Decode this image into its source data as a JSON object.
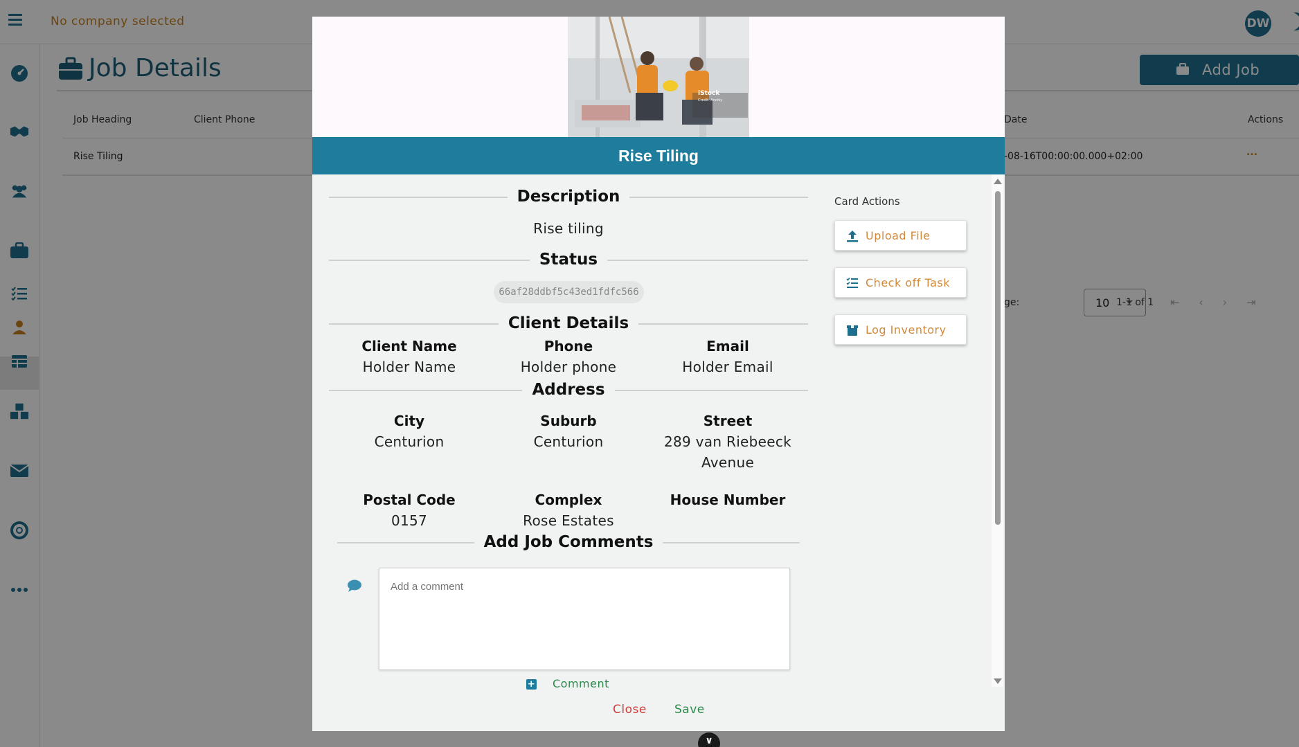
{
  "app": {
    "company_status": "No company selected",
    "user_initials": "DW"
  },
  "page": {
    "title": "Job Details",
    "add_job_label": "Add Job"
  },
  "table": {
    "headers": [
      "Job Heading",
      "Client Phone",
      "Date",
      "Actions"
    ],
    "rows": [
      {
        "job_heading": "Rise Tiling",
        "date": "-08-16T00:00:00.000+02:00",
        "actions": "..."
      }
    ],
    "rows_per_page_label": "ge:",
    "rows_per_page": "10",
    "range": "1-1 of 1"
  },
  "modal": {
    "title": "Rise Tiling",
    "image_watermark": "iStock",
    "image_credit": "Credit: Anchiy",
    "description": {
      "heading": "Description",
      "value": "Rise tiling"
    },
    "status": {
      "heading": "Status",
      "value": "66af28ddbf5c43ed1fdfc566"
    },
    "client": {
      "heading": "Client Details",
      "name_label": "Client Name",
      "name_value": "Holder Name",
      "phone_label": "Phone",
      "phone_value": "Holder phone",
      "email_label": "Email",
      "email_value": "Holder Email"
    },
    "address": {
      "heading": "Address",
      "city_label": "City",
      "city_value": "Centurion",
      "suburb_label": "Suburb",
      "suburb_value": "Centurion",
      "street_label": "Street",
      "street_value_line1": "289 van Riebeeck",
      "street_value_line2": "Avenue",
      "postal_label": "Postal Code",
      "postal_value": "0157",
      "complex_label": "Complex",
      "complex_value": "Rose Estates",
      "house_label": "House Number"
    },
    "comments": {
      "heading": "Add Job Comments",
      "placeholder": "Add a comment",
      "comment_button": "Comment"
    },
    "card_actions": {
      "title": "Card Actions",
      "upload": "Upload File",
      "check": "Check off Task",
      "inventory": "Log Inventory"
    },
    "close_label": "Close",
    "save_label": "Save"
  },
  "colors": {
    "primary": "#1e7c9c",
    "accent_orange": "#d28a3a",
    "danger": "#d03b3b",
    "success": "#2a8a4a"
  }
}
